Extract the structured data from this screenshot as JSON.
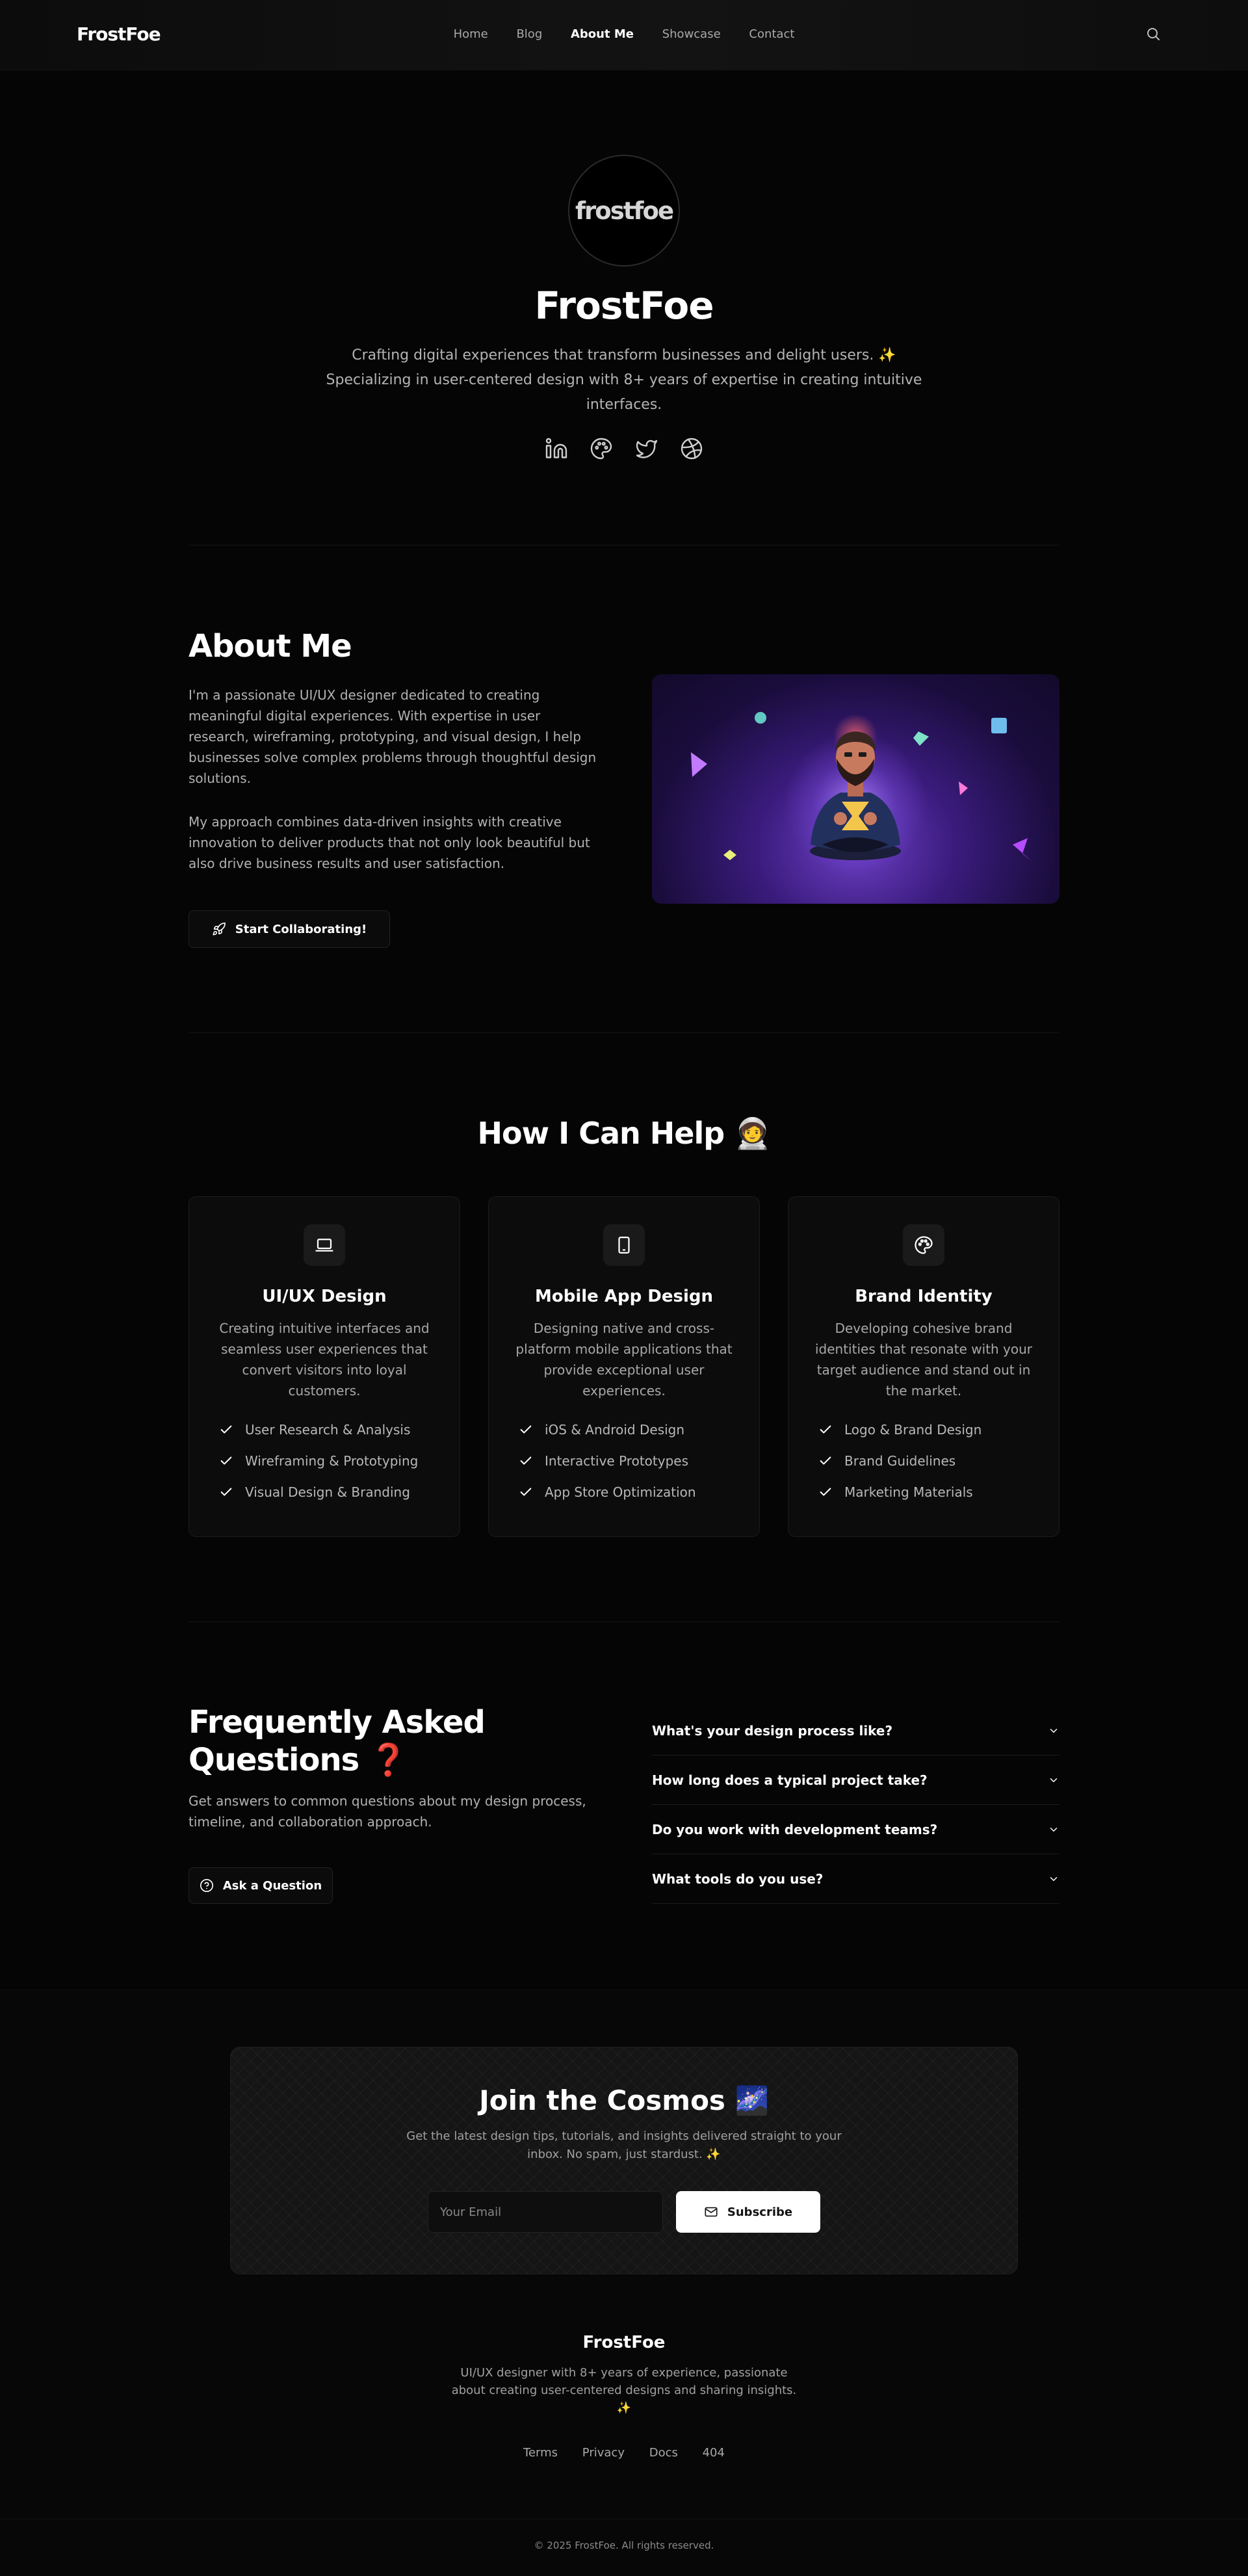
{
  "header": {
    "logo": "FrostFoe",
    "nav": [
      "Home",
      "Blog",
      "About Me",
      "Showcase",
      "Contact"
    ],
    "active": "About Me"
  },
  "hero": {
    "avatar_text": "frostfoe",
    "name": "FrostFoe",
    "bio": "Crafting digital experiences that transform businesses and delight users. ✨ Specializing in user-centered design with 8+ years of expertise in creating intuitive interfaces.",
    "socials": [
      "linkedin-icon",
      "palette-icon",
      "twitter-icon",
      "dribbble-icon"
    ]
  },
  "about": {
    "title": "About Me",
    "p1": "I'm a passionate UI/UX designer dedicated to creating meaningful digital experiences. With expertise in user research, wireframing, prototyping, and visual design, I help businesses solve complex problems through thoughtful design solutions.",
    "p2": "My approach combines data-driven insights with creative innovation to deliver products that not only look beautiful but also drive business results and user satisfaction.",
    "cta": "Start Collaborating!"
  },
  "services": {
    "title": "How I Can Help 🧑‍🚀",
    "cards": [
      {
        "icon": "laptop-icon",
        "title": "UI/UX Design",
        "desc": "Creating intuitive interfaces and seamless user experiences that convert visitors into loyal customers.",
        "features": [
          "User Research & Analysis",
          "Wireframing & Prototyping",
          "Visual Design & Branding"
        ]
      },
      {
        "icon": "smartphone-icon",
        "title": "Mobile App Design",
        "desc": "Designing native and cross-platform mobile applications that provide exceptional user experiences.",
        "features": [
          "iOS & Android Design",
          "Interactive Prototypes",
          "App Store Optimization"
        ]
      },
      {
        "icon": "palette-icon",
        "title": "Brand Identity",
        "desc": "Developing cohesive brand identities that resonate with your target audience and stand out in the market.",
        "features": [
          "Logo & Brand Design",
          "Brand Guidelines",
          "Marketing Materials"
        ]
      }
    ]
  },
  "faq": {
    "title": "Frequently Asked Questions ❓",
    "subtitle": "Get answers to common questions about my design process, timeline, and collaboration approach.",
    "cta": "Ask a Question",
    "questions": [
      "What's your design process like?",
      "How long does a typical project take?",
      "Do you work with development teams?",
      "What tools do you use?"
    ]
  },
  "newsletter": {
    "title": "Join the Cosmos 🌌",
    "subtitle": "Get the latest design tips, tutorials, and insights delivered straight to your inbox. No spam, just stardust. ✨",
    "placeholder": "Your Email",
    "button": "Subscribe"
  },
  "footer": {
    "name": "FrostFoe",
    "desc": "UI/UX designer with 8+ years of experience, passionate about creating user-centered designs and sharing insights. ✨",
    "links": [
      "Terms",
      "Privacy",
      "Docs",
      "404"
    ],
    "copyright": "© 2025 FrostFoe. All rights reserved."
  },
  "colors": {
    "background": "#050505",
    "card": "#0c0c0c",
    "text_muted": "#b2b2b2",
    "illustration_purple": "#6b3fc4"
  }
}
